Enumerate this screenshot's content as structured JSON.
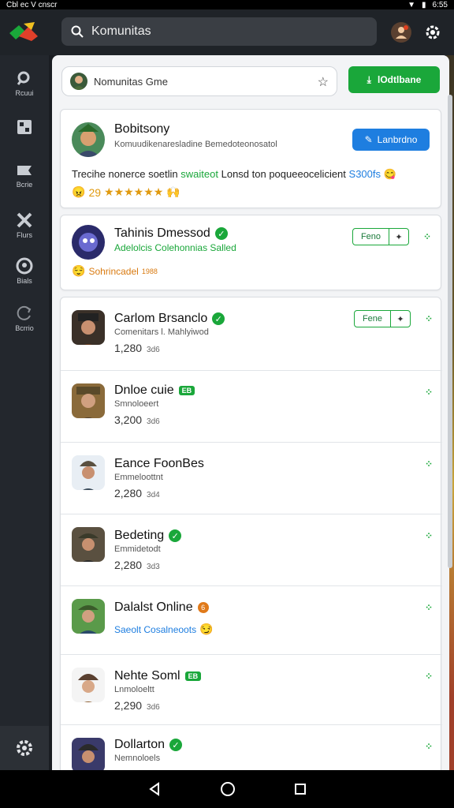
{
  "status": {
    "left": "Cbl ec V cnscr",
    "time": "6:55"
  },
  "search": {
    "value": "Komunitas"
  },
  "sidebar": {
    "items": [
      {
        "label": "Rcuui",
        "icon": "search-icon"
      },
      {
        "label": "",
        "icon": "grid-icon"
      },
      {
        "label": "Bcrie",
        "icon": "flag-icon"
      },
      {
        "label": "Flurs",
        "icon": "tools-icon"
      },
      {
        "label": "Bials",
        "icon": "shield-icon"
      },
      {
        "label": "Bcrrio",
        "icon": "refresh-icon"
      }
    ]
  },
  "group": {
    "placeholder": "Nomunitas Gme",
    "button_label": "lOdtlbane"
  },
  "featured": {
    "title": "Bobitsony",
    "subtitle": "Komuudikenaresladine Bemedoteonosatol",
    "button_label": "Lanbrdno",
    "desc_a": "Trecihe nonerce soetlin",
    "desc_b": "swaiteot",
    "desc_c": "Lonsd ton poqueeocelicient",
    "desc_d": "S300fs",
    "rating": "29"
  },
  "card2": {
    "title": "Tahinis Dmessod",
    "subtitle": "Adelolcis Colehonnias Salled",
    "follow_label": "Feno",
    "note": "Sohrincadel",
    "note_small": "1988"
  },
  "list": [
    {
      "title": "Carlom Brsanclo",
      "badge": "check",
      "subtitle": "Comenitars l. Mahlyiwod",
      "count": "1,280",
      "count_small": "3d6",
      "follow": "Fene"
    },
    {
      "title": "Dnloe cuie",
      "badge": "green",
      "badge_text": "EB",
      "subtitle": "Smnoloeert",
      "count": "3,200",
      "count_small": "3d6"
    },
    {
      "title": "Eance FoonBes",
      "badge": "",
      "subtitle": "Emmeloottnt",
      "count": "2,280",
      "count_small": "3d4"
    },
    {
      "title": "Bedeting",
      "badge": "check",
      "subtitle": "Emmidetodt",
      "count": "2,280",
      "count_small": "3d3"
    },
    {
      "title": "Dalalst Online",
      "badge": "orange",
      "badge_text": "6",
      "subtitle": "",
      "note": "Saeolt Cosalneoots"
    },
    {
      "title": "Nehte Soml",
      "badge": "green",
      "badge_text": "EB",
      "subtitle": "Lnmoloeltt",
      "count": "2,290",
      "count_small": "3d6"
    },
    {
      "title": "Dollarton",
      "badge": "check",
      "subtitle": "Nemnoloels",
      "count": "",
      "count_small": ""
    }
  ],
  "colors": {
    "green": "#1aa73a",
    "blue": "#1e7ee0",
    "sidebar": "#23272d"
  }
}
